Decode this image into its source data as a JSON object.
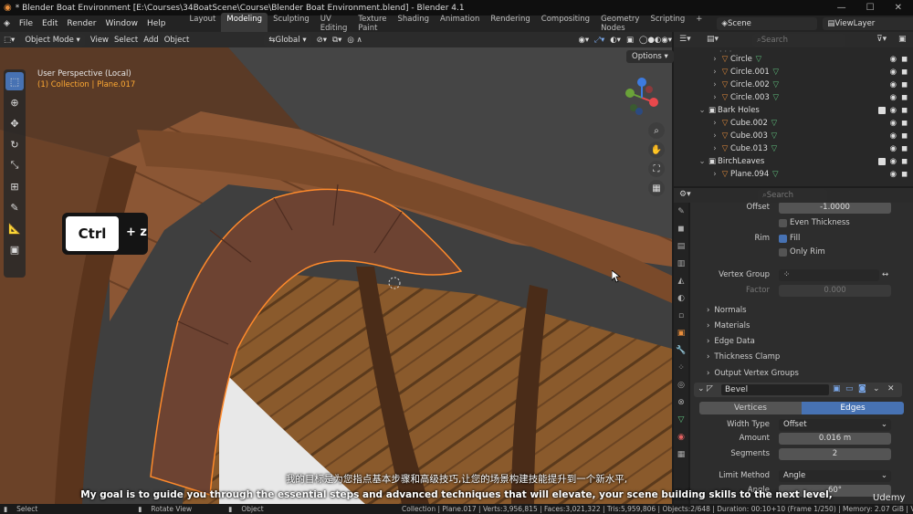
{
  "window": {
    "title": "* Blender Boat Environment [E:\\Courses\\34BoatScene\\Course\\Blender Boat Environment.blend] - Blender 4.1"
  },
  "menu": {
    "items": [
      "File",
      "Edit",
      "Render",
      "Window",
      "Help"
    ]
  },
  "workspaces": [
    "Layout",
    "Modeling",
    "Sculpting",
    "UV Editing",
    "Texture Paint",
    "Shading",
    "Animation",
    "Rendering",
    "Compositing",
    "Geometry Nodes",
    "Scripting"
  ],
  "active_workspace": "Modeling",
  "scene_name": "Scene",
  "view_layer": "ViewLayer",
  "viewport_header": {
    "mode": "Object Mode",
    "menus": [
      "View",
      "Select",
      "Add",
      "Object"
    ],
    "transform": "Global"
  },
  "viewport_info": {
    "line1": "User Perspective (Local)",
    "collection": "(1) Collection",
    "object": "Plane.017"
  },
  "options_label": "Options",
  "key_overlay": {
    "key": "Ctrl",
    "plus": "+ z"
  },
  "outliner": {
    "search_placeholder": "Search",
    "rows": [
      {
        "name": "Circle",
        "type": "obj",
        "indent": 2
      },
      {
        "name": "Circle.001",
        "type": "obj",
        "indent": 2
      },
      {
        "name": "Circle.002",
        "type": "obj",
        "indent": 2
      },
      {
        "name": "Circle.003",
        "type": "obj",
        "indent": 2
      },
      {
        "name": "Bark Holes",
        "type": "coll",
        "indent": 1
      },
      {
        "name": "Cube.002",
        "type": "obj",
        "indent": 2
      },
      {
        "name": "Cube.003",
        "type": "obj",
        "indent": 2
      },
      {
        "name": "Cube.013",
        "type": "obj",
        "indent": 2
      },
      {
        "name": "BirchLeaves",
        "type": "coll",
        "indent": 1
      },
      {
        "name": "Plane.094",
        "type": "obj",
        "indent": 2
      }
    ]
  },
  "properties": {
    "search_placeholder": "Search",
    "offset_label": "Offset",
    "offset_value": "-1.0000",
    "even_thickness": "Even Thickness",
    "rim_label": "Rim",
    "fill_label": "Fill",
    "only_rim": "Only Rim",
    "vertex_group_label": "Vertex Group",
    "factor_label": "Factor",
    "factor_value": "0.000",
    "panels": [
      "Normals",
      "Materials",
      "Edge Data",
      "Thickness Clamp",
      "Output Vertex Groups"
    ],
    "modifier_name": "Bevel",
    "tab_vertices": "Vertices",
    "tab_edges": "Edges",
    "width_type_label": "Width Type",
    "width_type_value": "Offset",
    "amount_label": "Amount",
    "amount_value": "0.016 m",
    "segments_label": "Segments",
    "segments_value": "2",
    "limit_method_label": "Limit Method",
    "limit_method_value": "Angle",
    "angle_label": "Angle",
    "angle_value": "60°"
  },
  "status": {
    "select": "Select",
    "rotate": "Rotate View",
    "object": "Object",
    "stats": "Collection | Plane.017 | Verts:3,956,815 | Faces:3,021,322 | Tris:5,959,806 | Objects:2/648 | Duration: 00:10+10 (Frame 1/250) | Memory: 2.07 GiB | VRAM"
  },
  "subtitles": {
    "cn": "我的目标是为您指点基本步骤和高级技巧,让您的场景构建技能提升到一个新水平,",
    "en": "My goal is to guide you through the essential steps and advanced techniques that will elevate, your scene building skills to the next level,"
  },
  "watermark": "Udemy",
  "colors": {
    "accent": "#4772b3",
    "object_orange": "#e88e3c",
    "mesh_green": "#5fc27e"
  }
}
